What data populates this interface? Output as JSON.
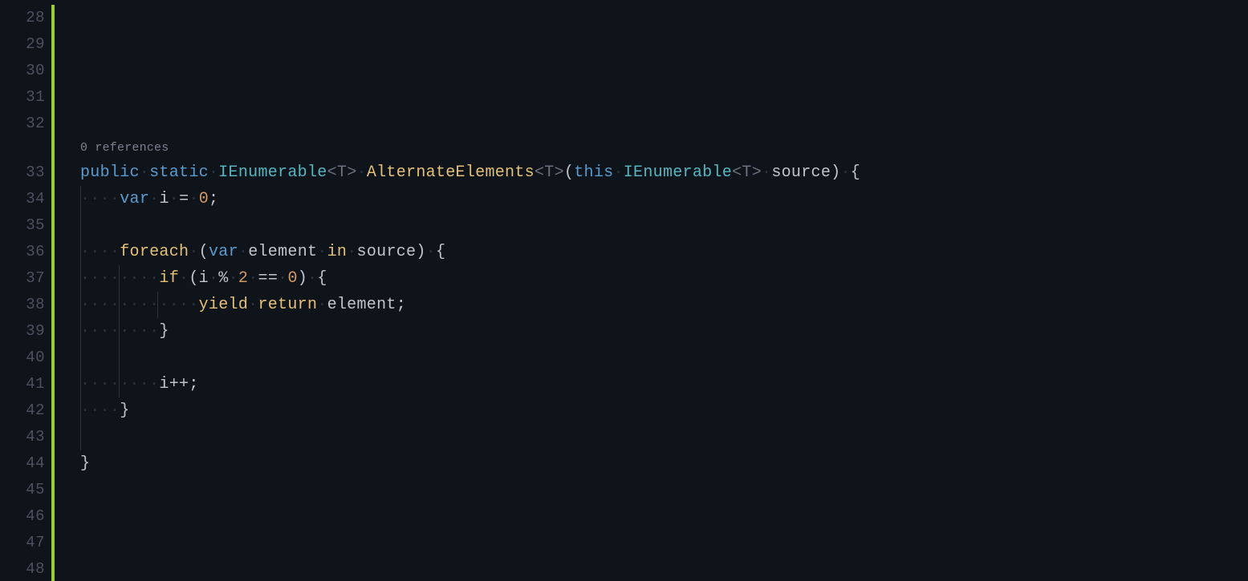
{
  "gutter": {
    "lines": [
      "28",
      "29",
      "30",
      "31",
      "32",
      "33",
      "34",
      "35",
      "36",
      "37",
      "38",
      "39",
      "40",
      "41",
      "42",
      "43",
      "44",
      "45",
      "46",
      "47",
      "48"
    ]
  },
  "codelens": {
    "references": "0 references"
  },
  "code": {
    "l33": {
      "public": "public",
      "static": "static",
      "ienum1": "IEnumerable",
      "t1_open": "<",
      "t1": "T",
      "t1_close": ">",
      "method": "AlternateElements",
      "t2_open": "<",
      "t2": "T",
      "t2_close": ">",
      "paren_open": "(",
      "this": "this",
      "ienum2": "IEnumerable",
      "t3_open": "<",
      "t3": "T",
      "t3_close": ">",
      "source": "source",
      "paren_close": ")",
      "brace": "{"
    },
    "l34": {
      "var": "var",
      "i": "i",
      "eq": "=",
      "zero": "0",
      "semi": ";"
    },
    "l36": {
      "foreach": "foreach",
      "paren_open": "(",
      "var": "var",
      "element": "element",
      "in": "in",
      "source": "source",
      "paren_close": ")",
      "brace": "{"
    },
    "l37": {
      "if": "if",
      "paren_open": "(",
      "i": "i",
      "mod": "%",
      "two": "2",
      "eq": "==",
      "zero": "0",
      "paren_close": ")",
      "brace": "{"
    },
    "l38": {
      "yield": "yield",
      "return": "return",
      "element": "element",
      "semi": ";"
    },
    "l39": {
      "brace": "}"
    },
    "l41": {
      "i": "i",
      "inc": "++",
      "semi": ";"
    },
    "l42": {
      "brace": "}"
    },
    "l44": {
      "brace": "}"
    }
  }
}
